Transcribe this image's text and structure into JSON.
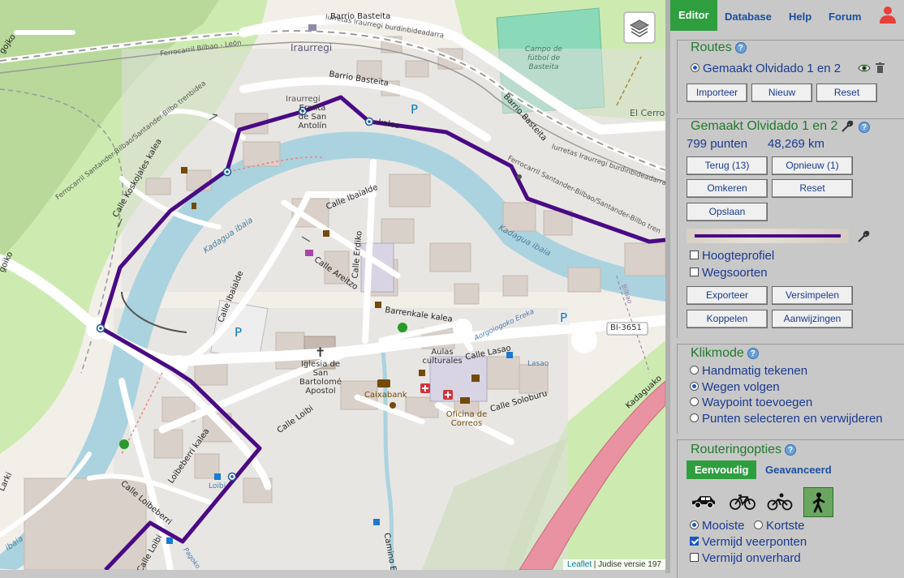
{
  "map": {
    "labels": {
      "barrio_basteita_1": "Barrio Basteita",
      "barrio_basteita_2": "Barrio Basteita",
      "barrio_basteita_3": "Barrio Basteita",
      "iraurregi": "Iraurregi",
      "iraurregi_station": "Iraurregi",
      "ferrocarril_bilbao_leon": "Ferrocarril Bilbao - León",
      "ferrocarril_santander_1": "Ferrocarril Santander-Bilbao/Santander-Bilbo trenbidea",
      "ferrocarril_santander_2": "Ferrocarril Santander-Bilbao/Santander-Bilbo tren",
      "burdinbideadarra_1": "Iurretas Iraurregi burdinbideadarra",
      "burdinbideadarra_2": "Iurretas Iraurregi burdinbideadarra",
      "campo_futbol": "Campo de fútbol de Basteita",
      "el_cerro": "El Cerro",
      "ermita": "Ermita de San Antolín",
      "calle_koskojales": "Calle Koskojales kalea",
      "kalea_1": "kalea",
      "calle_ibaialde_1": "Calle Ibaialde",
      "calle_ibaialde_2": "Calle Ibaialde",
      "calle_erdiko": "Calle Erdiko",
      "calle_areitzo": "Calle Areitzo",
      "kadagua_ibaia_1": "Kadagua ibaia",
      "kadagua_ibaia_2": "Kadagua ibaia",
      "kadagua_ibaia_3": "ibaia",
      "barrenkale": "Barrenkale kalea",
      "bi3651": "BI-3651",
      "bilbao": "Bilbao",
      "aorgoiogoko": "Aorgoiogoko Ereka",
      "aulas_culturales": "Aulas culturales",
      "calle_lasao": "Calle Lasao",
      "lasao": "Lasao",
      "iglesia": "Iglesia de San Bartolomé Apostol",
      "caixabank": "Caixabank",
      "oficina_correos": "Oficina de Correos",
      "calle_soloburu": "Calle Soloburu",
      "calle_loibi_1": "Calle Loibi",
      "calle_loibi_2": "Calle Loibi",
      "loibeberri": "Loibeberri kalea",
      "calle_loibeberri": "Calle Loibeberri",
      "loibi_stop": "Loibi",
      "camino": "Camino E",
      "kadaguako": "Kadaguako",
      "larki": "Larki",
      "ojoiko_1": "gojko",
      "ojoiko_2": "goiko",
      "ibaia_bottom": "ibaia",
      "pagoka": "Pagoko",
      "barrio_basteita_small": "Barrio"
    },
    "parking": "P",
    "layers_icon": "layers-icon",
    "attribution": {
      "link": "Leaflet",
      "text": " | Judise versie 197"
    },
    "colors": {
      "route": "#4a0a84",
      "water": "#aad3df",
      "park": "#c8facc",
      "road_major": "#ffffff",
      "rail": "#9a9a9a",
      "trunk": "#e892a2"
    }
  },
  "panel": {
    "tabs": {
      "editor": "Editor",
      "database": "Database",
      "help": "Help",
      "forum": "Forum"
    },
    "routes": {
      "title": "Routes",
      "help": "?",
      "route_name": "Gemaakt Olvidado 1 en 2",
      "import": "Importeer",
      "new": "Nieuw",
      "reset": "Reset"
    },
    "route_detail": {
      "title": "Gemaakt Olvidado 1 en 2",
      "help": "?",
      "points": "799 punten",
      "distance": "48,269 km",
      "back": "Terug (13)",
      "redo": "Opnieuw (1)",
      "reverse": "Omkeren",
      "reset": "Reset",
      "save": "Opslaan",
      "height_profile": "Hoogteprofiel",
      "road_types": "Wegsoorten",
      "export": "Exporteer",
      "simplify": "Versimpelen",
      "link": "Koppelen",
      "directions": "Aanwijzingen"
    },
    "click_mode": {
      "title": "Klikmode",
      "help": "?",
      "options": [
        "Handmatig tekenen",
        "Wegen volgen",
        "Waypoint toevoegen",
        "Punten selecteren en verwijderen"
      ],
      "selected": 1
    },
    "routing": {
      "title": "Routeringopties",
      "help": "?",
      "simple": "Eenvoudig",
      "advanced": "Geavanceerd",
      "profiles": [
        "car-icon",
        "bicycle-icon",
        "mountain-bike-icon",
        "pedestrian-icon"
      ],
      "active_profile": 3,
      "mooiste": "Mooiste",
      "kortste": "Kortste",
      "avoid_ferries": "Vermijd veerponten",
      "avoid_unpaved": "Vermijd onverhard"
    },
    "accent": "#2e9e3e",
    "link_color": "#1a4fa0",
    "title_color": "#1f7a2a"
  }
}
